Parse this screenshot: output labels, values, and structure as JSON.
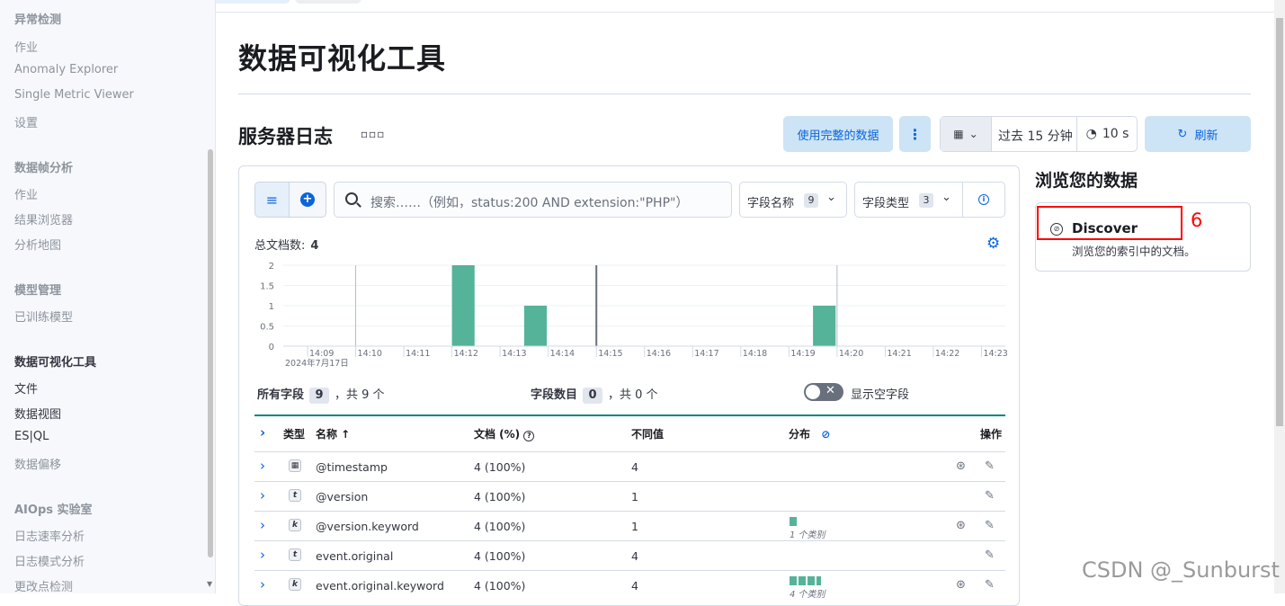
{
  "sidebar": {
    "items": [
      {
        "label": "异常检测",
        "style": "head"
      },
      {
        "label": "作业",
        "style": "item"
      },
      {
        "label": "Anomaly Explorer",
        "style": "item"
      },
      {
        "label": "Single Metric Viewer",
        "style": "item"
      },
      {
        "label": "设置",
        "style": "item"
      },
      {
        "label": "数据帧分析",
        "style": "head"
      },
      {
        "label": "作业",
        "style": "item"
      },
      {
        "label": "结果浏览器",
        "style": "item"
      },
      {
        "label": "分析地图",
        "style": "item"
      },
      {
        "label": "模型管理",
        "style": "head"
      },
      {
        "label": "已训练模型",
        "style": "item"
      },
      {
        "label": "数据可视化工具",
        "style": "head-dark"
      },
      {
        "label": "文件",
        "style": "dark"
      },
      {
        "label": "数据视图",
        "style": "dark"
      },
      {
        "label": "ES|QL",
        "style": "dark"
      },
      {
        "label": "数据偏移",
        "style": "item"
      },
      {
        "label": "AIOps 实验室",
        "style": "head"
      },
      {
        "label": "日志速率分析",
        "style": "item"
      },
      {
        "label": "日志模式分析",
        "style": "item"
      },
      {
        "label": "更改点检测",
        "style": "item"
      }
    ]
  },
  "page": {
    "title": "数据可视化工具",
    "subtitle": "服务器日志",
    "more_dots": "▫▫▫"
  },
  "toolbar": {
    "full_data_label": "使用完整的数据",
    "time_range": "过去 15 分钟",
    "refresh_interval": "10 s",
    "refresh_label": "刷新"
  },
  "search": {
    "placeholder": "搜索……（例如，status:200 AND extension:\"PHP\"）",
    "field_name_label": "字段名称",
    "field_name_count": "9",
    "field_type_label": "字段类型",
    "field_type_count": "3"
  },
  "doc_count": {
    "label": "总文档数:",
    "value": "4"
  },
  "chart_data": {
    "type": "bar",
    "x": [
      "14:09",
      "14:10",
      "14:11",
      "14:12",
      "14:13",
      "14:14",
      "14:15",
      "14:16",
      "14:17",
      "14:18",
      "14:19",
      "14:20",
      "14:21",
      "14:22",
      "14:23"
    ],
    "bars": [
      {
        "start": "14:12",
        "value": 2
      },
      {
        "start": "14:13.5",
        "value": 1
      },
      {
        "start": "14:19.5",
        "value": 1
      }
    ],
    "yticks": [
      "0",
      "0.5",
      "1",
      "1.5",
      "2"
    ],
    "ylim": [
      0,
      2
    ],
    "date_label": "2024年7月17日",
    "bar_color": "#54b399",
    "markers": [
      "14:10",
      "14:15",
      "14:20"
    ]
  },
  "summary": {
    "all_fields_label": "所有字段",
    "all_fields_count": "9",
    "all_fields_total": "，共 9 个",
    "field_num_label": "字段数目",
    "field_num_count": "0",
    "field_num_total": "，共 0 个",
    "show_empty_label": "显示空字段"
  },
  "table": {
    "headers": {
      "type": "类型",
      "name": "名称 ↑",
      "docs": "文档 (%)",
      "distinct": "不同值",
      "dist": "分布",
      "actions": "操作"
    },
    "rows": [
      {
        "type": "date",
        "name": "@timestamp",
        "docs": "4 (100%)",
        "distinct": "4",
        "dist": "",
        "dist_label": ""
      },
      {
        "type": "t",
        "name": "@version",
        "docs": "4 (100%)",
        "distinct": "1",
        "dist": "",
        "dist_label": ""
      },
      {
        "type": "k",
        "name": "@version.keyword",
        "docs": "4 (100%)",
        "distinct": "1",
        "dist": "1",
        "dist_label": "1 个类别"
      },
      {
        "type": "t",
        "name": "event.original",
        "docs": "4 (100%)",
        "distinct": "4",
        "dist": "",
        "dist_label": ""
      },
      {
        "type": "k",
        "name": "event.original.keyword",
        "docs": "4 (100%)",
        "distinct": "4",
        "dist": "4",
        "dist_label": "4 个类别"
      }
    ]
  },
  "right": {
    "title": "浏览您的数据",
    "card_title": "Discover",
    "card_desc": "浏览您的索引中的文档。",
    "annotation": "6"
  },
  "watermark": "CSDN @_Sunburst",
  "colors": {
    "accent": "#0b64dd",
    "bar": "#54b399",
    "table_rule": "#0a8680",
    "annotation": "#ff0000"
  }
}
